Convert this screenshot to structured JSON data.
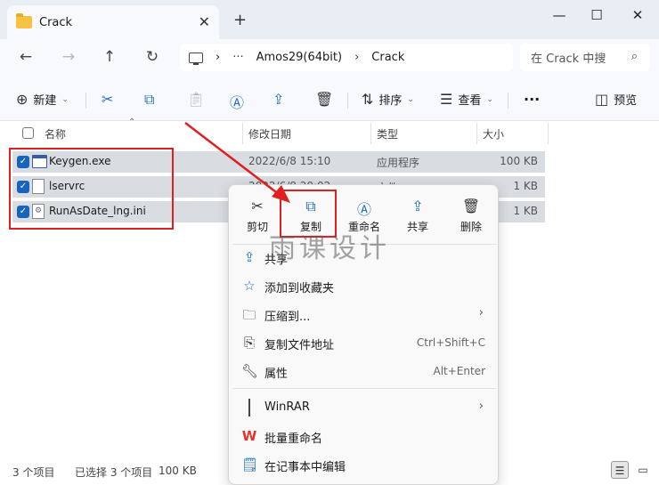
{
  "window": {
    "tab_title": "Crack",
    "tab_close": "✕",
    "new_tab": "+",
    "minimize": "—",
    "maximize": "☐",
    "close": "✕"
  },
  "nav": {
    "back": "←",
    "forward": "→",
    "up": "↑",
    "refresh": "↻"
  },
  "address": {
    "more": "···",
    "crumbs": [
      "Amos29(64bit)",
      "Crack"
    ],
    "separator": "›",
    "search_placeholder": "在 Crack 中搜"
  },
  "commandbar": {
    "new_label": "新建",
    "sort_label": "排序",
    "view_label": "查看",
    "more": "···",
    "preview_label": "预览"
  },
  "columns": {
    "name": "名称",
    "date": "修改日期",
    "type": "类型",
    "size": "大小"
  },
  "files": [
    {
      "name": "Keygen.exe",
      "date": "2022/6/8 15:10",
      "type": "应用程序",
      "size": "100 KB",
      "icon": "exe-icon",
      "selected": true
    },
    {
      "name": "lservrc",
      "date": "2022/6/8 20:02",
      "type": "文件",
      "size": "1 KB",
      "icon": "file-icon",
      "selected": true
    },
    {
      "name": "RunAsDate_lng.ini",
      "date": "",
      "type": "",
      "size": "1 KB",
      "icon": "ini-file-icon",
      "selected": true
    }
  ],
  "status": {
    "item_count": "3 个项目",
    "selection": "已选择 3 个项目",
    "selection_size": "100 KB"
  },
  "context_menu": {
    "quick_actions": [
      {
        "label": "剪切",
        "icon": "scissors-icon"
      },
      {
        "label": "复制",
        "icon": "copy-icon"
      },
      {
        "label": "重命名",
        "icon": "rename-icon"
      },
      {
        "label": "共享",
        "icon": "share-icon"
      },
      {
        "label": "删除",
        "icon": "trash-icon"
      }
    ],
    "items": [
      {
        "label": "共享",
        "shortcut": "",
        "submenu": false,
        "icon": "share-icon"
      },
      {
        "label": "添加到收藏夹",
        "shortcut": "",
        "submenu": false,
        "icon": "star-icon"
      },
      {
        "label": "压缩到...",
        "shortcut": "",
        "submenu": true,
        "icon": "zip-folder-icon"
      },
      {
        "label": "复制文件地址",
        "shortcut": "Ctrl+Shift+C",
        "submenu": false,
        "icon": "copy-path-icon"
      },
      {
        "label": "属性",
        "shortcut": "Alt+Enter",
        "submenu": false,
        "icon": "wrench-icon"
      },
      {
        "label": "WinRAR",
        "shortcut": "",
        "submenu": true,
        "icon": "winrar-icon"
      },
      {
        "label": "批量重命名",
        "shortcut": "",
        "submenu": false,
        "icon": "wps-icon"
      },
      {
        "label": "在记事本中编辑",
        "shortcut": "",
        "submenu": false,
        "icon": "notepad-icon"
      }
    ]
  },
  "watermark": "雨课设计",
  "colors": {
    "accent": "#1565c0",
    "selection_row": "#d9dde1",
    "annotation_red": "#e02020"
  }
}
